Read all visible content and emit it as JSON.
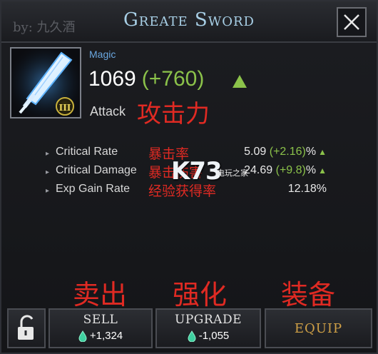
{
  "window": {
    "title": "Greate Sword",
    "watermark": "by: 九久酒"
  },
  "item": {
    "rarity": "Magic",
    "attack_value": "1069",
    "attack_bonus": "(+760)",
    "attack_label": "Attack",
    "attack_label_cn": "攻击力",
    "tier": "III",
    "icon": "sword-icon"
  },
  "stats": [
    {
      "name": "Critical Rate",
      "name_cn": "暴击率",
      "base": "5.09",
      "bonus": "(+2.16)",
      "suffix": "%",
      "trend": "up"
    },
    {
      "name": "Critical Damage",
      "name_cn": "暴击伤害",
      "base": "24.69",
      "bonus": "(+9.8)",
      "suffix": "%",
      "trend": "up"
    },
    {
      "name": "Exp Gain Rate",
      "name_cn": "经验获得率",
      "base": "12.18%",
      "bonus": "",
      "suffix": "",
      "trend": ""
    }
  ],
  "logo": {
    "main": "K73",
    "sub": "电玩之家"
  },
  "actions_cn": {
    "sell": "卖出",
    "upgrade": "强化",
    "equip": "装备"
  },
  "buttons": {
    "sell_label": "SELL",
    "sell_price": "+1,324",
    "upgrade_label": "UPGRADE",
    "upgrade_price": "-1,055",
    "equip_label": "EQUIP"
  },
  "colors": {
    "title": "#a8cfe6",
    "rarity_magic": "#6aa7e0",
    "bonus_green": "#8bc24a",
    "annotation_red": "#e02a23",
    "equip_gold": "#cfa046"
  }
}
